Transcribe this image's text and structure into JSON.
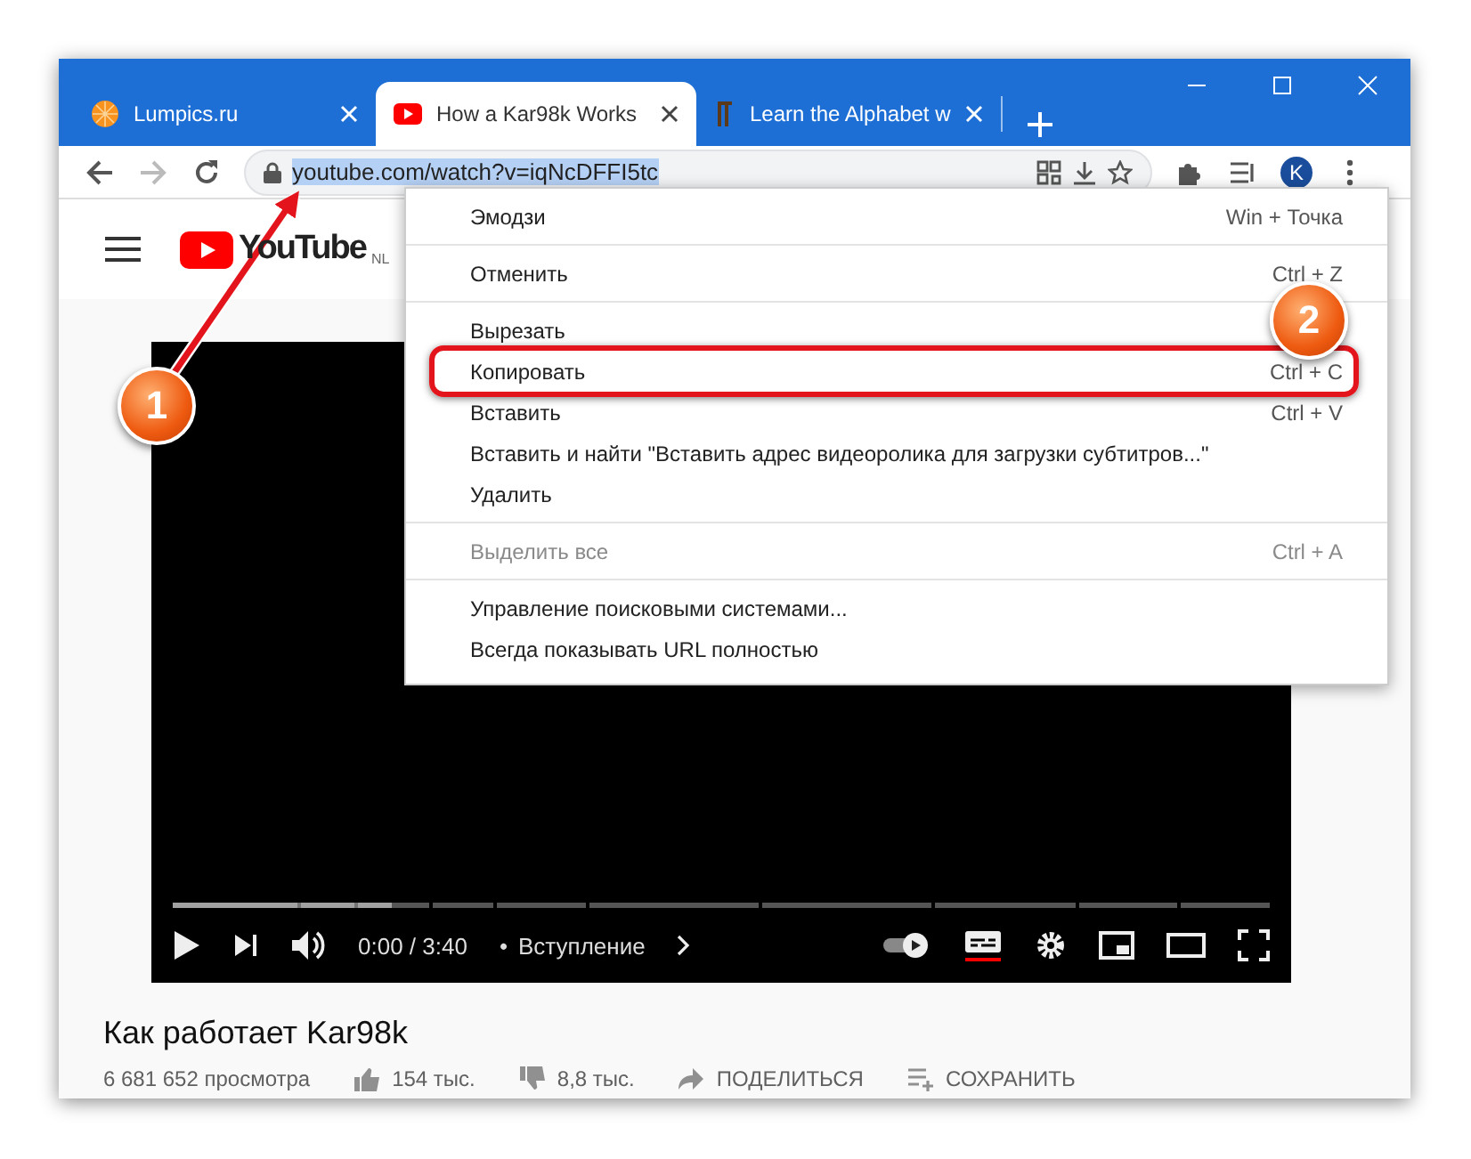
{
  "window": {
    "tabs": [
      {
        "title": "Lumpics.ru",
        "selected": false
      },
      {
        "title": "How a Kar98k Works",
        "selected": true
      },
      {
        "title": "Learn the Alphabet w",
        "selected": false
      }
    ]
  },
  "toolbar": {
    "forward_disabled": true,
    "url": "youtube.com/watch?v=iqNcDFFI5tc",
    "url_selected": true,
    "avatar": "K"
  },
  "page": {
    "logo": "YouTube",
    "region": "NL",
    "player": {
      "level": 0.2,
      "time": "0:00 / 3:40",
      "separator": "•",
      "chapter": "Вступление",
      "autoplay_on": true,
      "captions_on": true
    },
    "video_title": "Как работает Kar98k",
    "stats": {
      "views": "6 681 652 просмотра",
      "likes": "154 тыс.",
      "dislikes": "8,8 тыс.",
      "share": "ПОДЕЛИТЬСЯ",
      "save": "СОХРАНИТЬ"
    }
  },
  "context_menu": {
    "groups": [
      {
        "items": [
          {
            "label": "Эмодзи",
            "shortcut": "Win + Точка",
            "disabled": false,
            "highlighted": false
          }
        ]
      },
      {
        "items": [
          {
            "label": "Отменить",
            "shortcut": "Ctrl + Z",
            "disabled": false,
            "highlighted": false
          }
        ]
      },
      {
        "items": [
          {
            "label": "Вырезать",
            "disabled": false,
            "highlighted": false
          },
          {
            "label": "Копировать",
            "shortcut": "Ctrl + C",
            "disabled": false,
            "highlighted": true
          },
          {
            "label": "Вставить",
            "shortcut": "Ctrl + V",
            "disabled": false,
            "highlighted": false
          },
          {
            "label": "Вставить и найти \"Вставить адрес видеоролика для загрузки субтитров...\"",
            "disabled": false,
            "highlighted": false
          },
          {
            "label": "Удалить",
            "disabled": false,
            "highlighted": false
          }
        ]
      },
      {
        "items": [
          {
            "label": "Выделить все",
            "shortcut": "Ctrl + A",
            "disabled": true,
            "highlighted": false
          }
        ]
      },
      {
        "items": [
          {
            "label": "Управление поисковыми системами...",
            "disabled": false,
            "highlighted": false
          },
          {
            "label": "Всегда показывать URL полностью",
            "disabled": false,
            "highlighted": false
          }
        ]
      }
    ]
  },
  "annotations": [
    {
      "number": "1"
    },
    {
      "number": "2"
    }
  ]
}
